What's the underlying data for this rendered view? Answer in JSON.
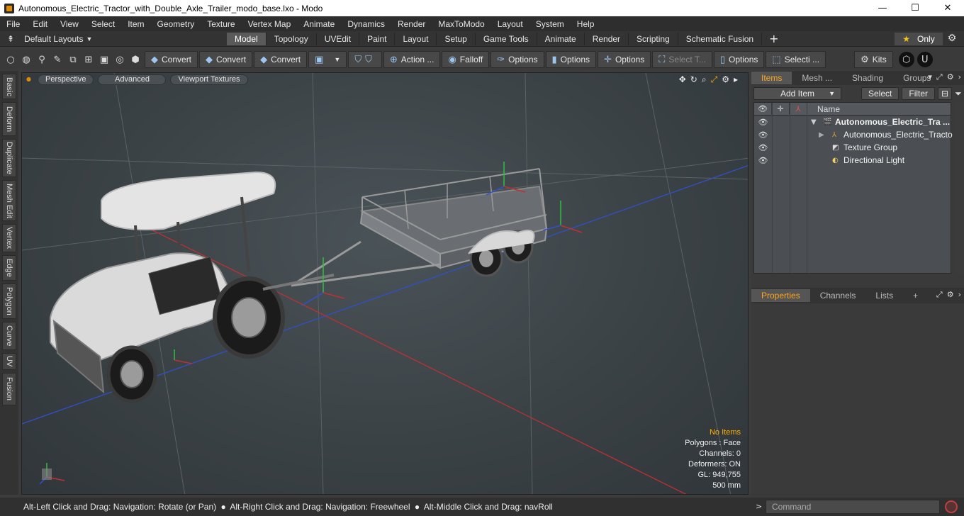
{
  "window": {
    "title": "Autonomous_Electric_Tractor_with_Double_Axle_Trailer_modo_base.lxo - Modo",
    "minimize": "—",
    "maximize": "☐",
    "close": "✕"
  },
  "menu": [
    "File",
    "Edit",
    "View",
    "Select",
    "Item",
    "Geometry",
    "Texture",
    "Vertex Map",
    "Animate",
    "Dynamics",
    "Render",
    "MaxToModo",
    "Layout",
    "System",
    "Help"
  ],
  "layoutbar": {
    "layout_selector": "Default Layouts",
    "tabs": [
      "Model",
      "Topology",
      "UVEdit",
      "Paint",
      "Layout",
      "Setup",
      "Game Tools",
      "Animate",
      "Render",
      "Scripting",
      "Schematic Fusion"
    ],
    "active_tab": "Model",
    "add_tab": "+",
    "only_label": "Only"
  },
  "toolbar": {
    "buttons": [
      {
        "label": "Convert",
        "icon": "convert-icon"
      },
      {
        "label": "Convert",
        "icon": "convert-icon"
      },
      {
        "label": "Convert",
        "icon": "convert-icon"
      },
      {
        "label": "Action ...",
        "icon": "action-center-icon"
      },
      {
        "label": "Falloff",
        "icon": "falloff-icon"
      },
      {
        "label": "Options",
        "icon": "options-icon"
      },
      {
        "label": "Options",
        "icon": "options-icon"
      },
      {
        "label": "Options",
        "icon": "options-icon"
      },
      {
        "label": "Select T...",
        "icon": "select-tool-icon"
      },
      {
        "label": "Options",
        "icon": "options-icon"
      },
      {
        "label": "Selecti ...",
        "icon": "selection-icon"
      },
      {
        "label": "Kits",
        "icon": "kits-icon"
      }
    ]
  },
  "left_tabs": [
    "Basic",
    "Deform",
    "Duplicate",
    "Mesh Edit",
    "Vertex",
    "Edge",
    "Polygon",
    "Curve",
    "UV",
    "Fusion"
  ],
  "viewport": {
    "tabs": [
      "Perspective",
      "Advanced",
      "Viewport Textures"
    ],
    "stats": {
      "selection": "No Items",
      "polygons": "Polygons : Face",
      "channels": "Channels: 0",
      "deformers": "Deformers: ON",
      "gl": "GL: 949,755",
      "scale": "500 mm"
    }
  },
  "items_panel": {
    "tabs": [
      "Items",
      "Mesh ...",
      "Shading",
      "Groups"
    ],
    "active_tab": "Items",
    "add_item": "Add Item",
    "select": "Select",
    "filter": "Filter",
    "column_name": "Name",
    "rows": [
      {
        "label": "Autonomous_Electric_Tra ...",
        "type": "scene",
        "bold": true
      },
      {
        "label": "Autonomous_Electric_Tracto ...",
        "type": "mesh",
        "bold": false
      },
      {
        "label": "Texture Group",
        "type": "texture",
        "bold": false
      },
      {
        "label": "Directional Light",
        "type": "light",
        "bold": false
      }
    ]
  },
  "properties_panel": {
    "tabs": [
      "Properties",
      "Channels",
      "Lists"
    ],
    "active_tab": "Properties",
    "add_tab": "+"
  },
  "statusbar": {
    "hints": [
      "Alt-Left Click and Drag: Navigation: Rotate (or Pan)",
      "Alt-Right Click and Drag: Navigation: Freewheel",
      "Alt-Middle Click and Drag: navRoll"
    ],
    "command_placeholder": "Command"
  },
  "colors": {
    "accent": "#ffa620",
    "viewport_bg": "#3b4246",
    "axis_x": "#c03030",
    "axis_y": "#30c040",
    "axis_z": "#3050d0"
  }
}
